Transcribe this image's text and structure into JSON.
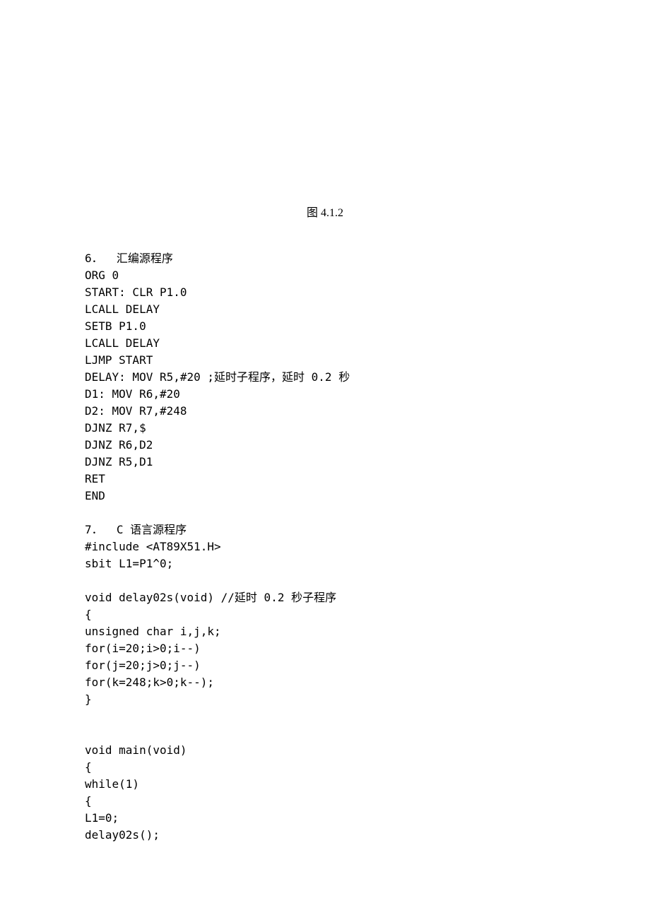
{
  "figure_caption": "图 4.1.2",
  "section6": {
    "heading": "6．  汇编源程序",
    "lines": [
      "ORG 0",
      "START: CLR P1.0",
      "LCALL DELAY",
      "SETB P1.0",
      "LCALL DELAY",
      "LJMP START",
      "DELAY: MOV R5,#20 ;延时子程序，延时 0.2 秒",
      "D1: MOV R6,#20",
      "D2: MOV R7,#248",
      "DJNZ R7,$",
      "DJNZ R6,D2",
      "DJNZ R5,D1",
      "RET",
      "END"
    ]
  },
  "section7": {
    "heading": "7．  C 语言源程序",
    "lines_block1": [
      "#include <AT89X51.H>",
      "sbit L1=P1^0;"
    ],
    "lines_block2": [
      "void delay02s(void) //延时 0.2 秒子程序",
      "{",
      "unsigned char i,j,k;",
      "for(i=20;i>0;i--)",
      "for(j=20;j>0;j--)",
      "for(k=248;k>0;k--);",
      "}"
    ],
    "lines_block3": [
      "void main(void)",
      "{",
      "while(1)",
      "{",
      "L1=0;",
      "delay02s();"
    ]
  }
}
